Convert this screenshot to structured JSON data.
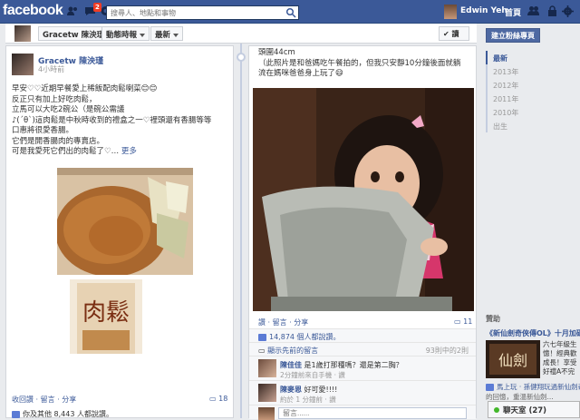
{
  "topbar": {
    "logo": "facebook",
    "notif_count": "2",
    "search_placeholder": "搜尋人、地點和事物",
    "user_name": "Edwin Yeh",
    "home_label": "首頁"
  },
  "header": {
    "profile_name": "Gracetw 陳泱瑾",
    "feed_label": "動態時報",
    "recent_label": "最新",
    "read_label": "讀"
  },
  "post1": {
    "author": "Gracetw 陳泱瑾",
    "time": "4小時前",
    "lines": [
      "早安♡♡近期早餐愛上稀飯配肉鬆喇菜😊😊",
      "反正只有加上好吃肉鬆，",
      "立馬可以大吃2碗公（是碗公需議",
      "♪(´θ`)這肉鬆是中秋時收到的禮盒之一♡裡頭還有香腸等等",
      "口惠將很愛香腸。",
      "它們是開香腸肉的專賣店。",
      "可是我愛死它們出的肉鬆了♡…"
    ],
    "more": "更多",
    "actions": "收回讚 · 留言 · 分享",
    "comment_count": "18",
    "likes": "你及其他 8,443 人都說讚。"
  },
  "post2": {
    "lines": [
      "頭圍44cm",
      "（此照片是和爸媽吃午餐拍的，但我只安靜10分鐘後面就躺",
      "流在媽咪爸爸身上玩了😄"
    ],
    "actions": "讚 · 留言 · 分享",
    "comment_count": "11",
    "likes": "14,874 個人都說讚。",
    "prev_comments": "顯示先前的留言",
    "prev_meta": "93則中的2則",
    "comments": [
      {
        "name": "陳佳佳",
        "text": "是1歲打那種嗎？還是第二胸？",
        "meta": "2分鐘前來自手機 · 讚"
      },
      {
        "name": "陳麥恩",
        "text": "好可愛!!!!",
        "meta": "約於 1 分鐘前 · 讚"
      }
    ],
    "comment_placeholder": "留言......"
  },
  "sidebar": {
    "create_page": "建立粉絲專頁",
    "years": [
      "最新",
      "2013年",
      "2012年",
      "2011年",
      "2010年",
      "出生"
    ],
    "sponsored": "贊助",
    "ad_title": "《新仙劍奇俠傳OL》十月加碼",
    "ad_img_text": "仙劍",
    "ad_lines": [
      "六七年級生",
      "憶！經典歡",
      "成長！享受",
      "好禮A不完"
    ],
    "ad_like": "馬上玩 · 孫健翔玩過新仙劍奇俠",
    "ad_sub": "的回憶，重溫新仙劍..."
  },
  "chat": {
    "label": "聊天室 (27)"
  }
}
